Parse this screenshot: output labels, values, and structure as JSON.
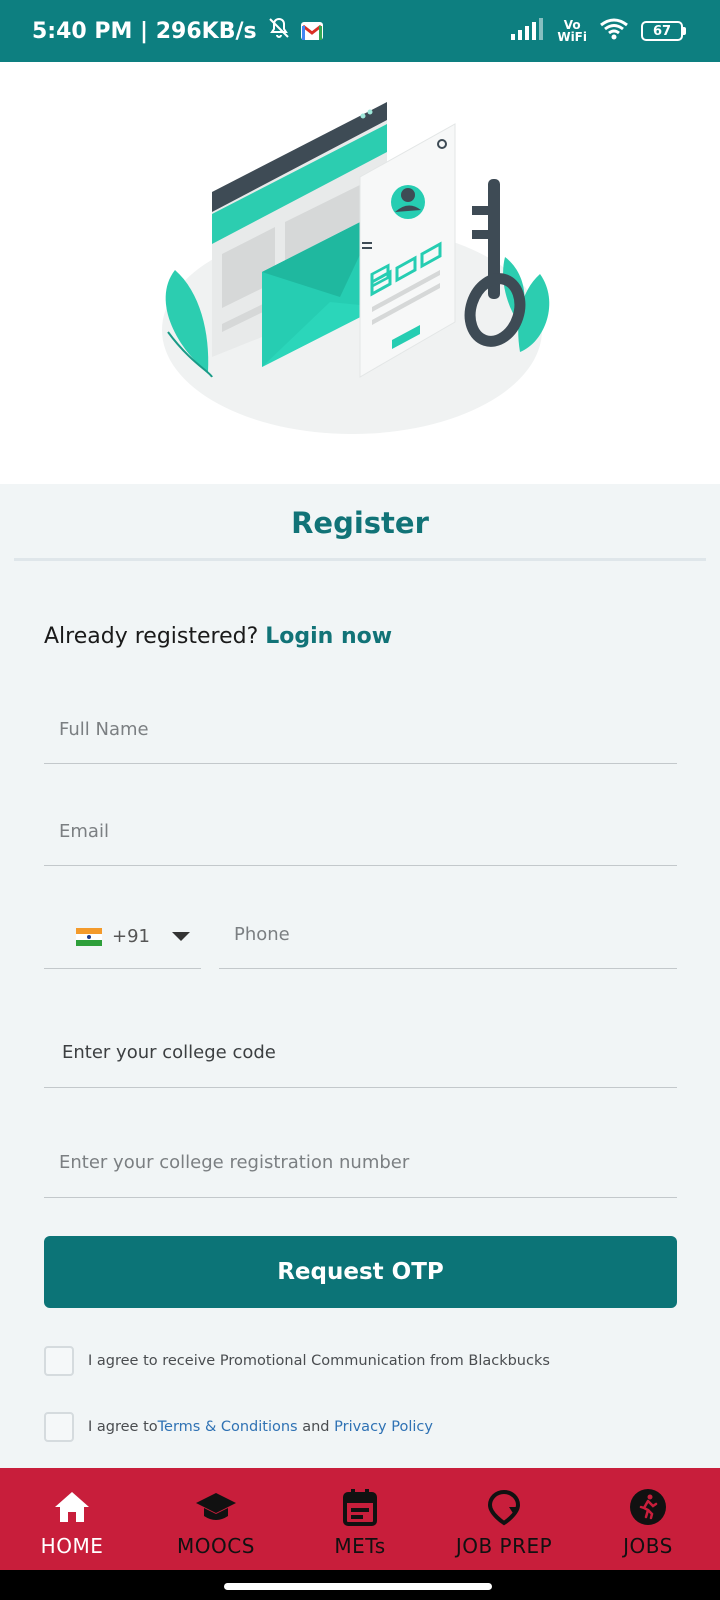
{
  "status_bar": {
    "time_speed": "5:40 PM | 296KB/s",
    "vowifi_top": "Vo",
    "vowifi_bottom": "WiFi",
    "battery": "67",
    "bg_color": "#0d7f80"
  },
  "register": {
    "title": "Register",
    "already_text": "Already registered? ",
    "login_link": "Login now"
  },
  "form": {
    "full_name_placeholder": "Full Name",
    "email_placeholder": "Email",
    "country_code": "+91",
    "phone_placeholder": "Phone",
    "college_code_placeholder": "Enter your college code",
    "registration_placeholder": "Enter your college registration number",
    "otp_button": "Request OTP"
  },
  "consents": {
    "promo_text": "I agree to receive Promotional Communication from Blackbucks",
    "terms_prefix": "I agree to ",
    "terms_link": "Terms & Conditions",
    "terms_and": " and ",
    "privacy_link": "Privacy Policy"
  },
  "bottom_nav": {
    "bg_color": "#c81e3b",
    "items": [
      {
        "label": "HOME",
        "icon": "home-icon",
        "active": true
      },
      {
        "label": "MOOCS",
        "icon": "graduation-cap-icon",
        "active": false
      },
      {
        "label": "METs",
        "icon": "calendar-icon",
        "active": false
      },
      {
        "label": "JOB PREP",
        "icon": "job-prep-icon",
        "active": false
      },
      {
        "label": "JOBS",
        "icon": "running-person-icon",
        "active": false
      }
    ]
  },
  "colors": {
    "accent": "#117377",
    "button": "#0c7477",
    "link": "#2f72b4"
  }
}
